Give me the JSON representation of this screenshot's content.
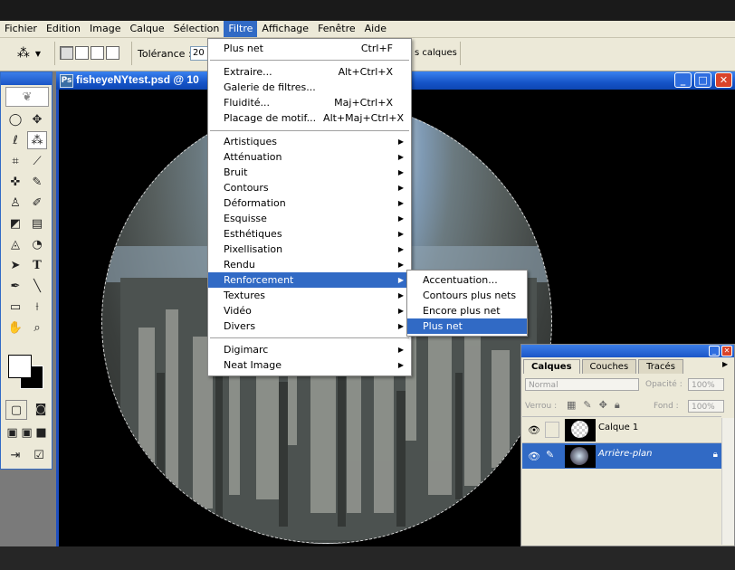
{
  "menubar": {
    "items": [
      "Fichier",
      "Edition",
      "Image",
      "Calque",
      "Sélection",
      "Filtre",
      "Affichage",
      "Fenêtre",
      "Aide"
    ],
    "active": "Filtre"
  },
  "options": {
    "tolerance_label": "Tolérance :",
    "tolerance_value": "20",
    "layers_text": "s calques"
  },
  "document": {
    "title": "fisheyeNYtest.psd @ 10"
  },
  "filter_menu": {
    "last_filter": {
      "label": "Plus net",
      "shortcut": "Ctrl+F"
    },
    "group1": [
      {
        "label": "Extraire...",
        "shortcut": "Alt+Ctrl+X"
      },
      {
        "label": "Galerie de filtres...",
        "shortcut": ""
      },
      {
        "label": "Fluidité...",
        "shortcut": "Maj+Ctrl+X"
      },
      {
        "label": "Placage de motif...",
        "shortcut": "Alt+Maj+Ctrl+X"
      }
    ],
    "categories": [
      "Artistiques",
      "Atténuation",
      "Bruit",
      "Contours",
      "Déformation",
      "Esquisse",
      "Esthétiques",
      "Pixellisation",
      "Rendu",
      "Renforcement",
      "Textures",
      "Vidéo",
      "Divers"
    ],
    "highlighted": "Renforcement",
    "plugins": [
      "Digimarc",
      "Neat Image"
    ]
  },
  "submenu": {
    "items": [
      "Accentuation...",
      "Contours plus nets",
      "Encore plus net",
      "Plus net"
    ],
    "highlighted": "Plus net"
  },
  "layers_panel": {
    "tabs": [
      "Calques",
      "Couches",
      "Tracés"
    ],
    "active_tab": "Calques",
    "blend_mode": "Normal",
    "opacity_label": "Opacité :",
    "opacity_value": "100%",
    "lock_label": "Verrou :",
    "fill_label": "Fond :",
    "fill_value": "100%",
    "layers": [
      {
        "name": "Calque 1",
        "selected": false
      },
      {
        "name": "Arrière-plan",
        "selected": true
      }
    ]
  },
  "colors": {
    "menu_highlight": "#316ac5",
    "title_bar": "#1655c8",
    "chrome": "#ece9d8"
  }
}
